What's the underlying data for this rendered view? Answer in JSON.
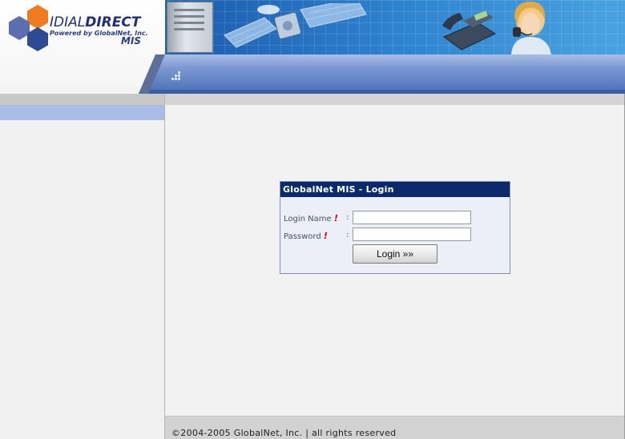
{
  "header": {
    "brand_idial": "IDIAL",
    "brand_direct": "DIRECT",
    "brand_powered": "Powered by GlobalNet, Inc.",
    "brand_mis": "MIS",
    "colors": {
      "banner": "#1f63b4",
      "band": "#7b97d2",
      "hex_orange": "#f07a20",
      "hex_blue": "#2e4a93"
    }
  },
  "login": {
    "title": "GlobalNet MIS - Login",
    "login_name_label": "Login Name",
    "password_label": "Password",
    "required_marker": "!",
    "colon": ":",
    "login_name_value": "",
    "password_value": "",
    "login_button_label": "Login »»",
    "colors": {
      "title_bg": "#0a2a6b",
      "required": "#d40000"
    }
  },
  "footer": {
    "copyright": "©2004-2005 GlobalNet, Inc. | all rights reserved"
  },
  "icons": [
    "logo-hexagons-icon",
    "server-icon",
    "satellite-icon",
    "telephone-icon",
    "support-person-icon",
    "dots-icon"
  ]
}
